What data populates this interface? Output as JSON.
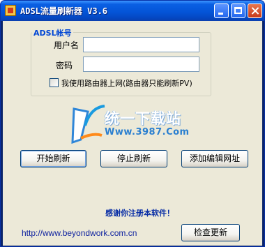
{
  "window": {
    "title": "ADSL流量刷新器 V3.6"
  },
  "account": {
    "group_label": "ADSL帐号",
    "username_label": "用户名",
    "username_value": "",
    "password_label": "密码",
    "password_value": "",
    "router_checkbox_label": "我使用路由器上网(路由器只能刷新PV)",
    "router_checked": false
  },
  "logo": {
    "title": "统一下载站",
    "url": "Www.3987.Com"
  },
  "buttons": {
    "start": "开始刷新",
    "stop": "停止刷新",
    "add_url": "添加编辑网址",
    "check_update": "检查更新"
  },
  "footer": {
    "thanks": "感谢你注册本软件！",
    "site": "http://www.beyondwork.com.cn"
  },
  "colors": {
    "title_bar": "#0a5fe3",
    "client_bg": "#ece9d8",
    "group_label": "#0046d5",
    "thanks_text": "#0a2fa6"
  }
}
